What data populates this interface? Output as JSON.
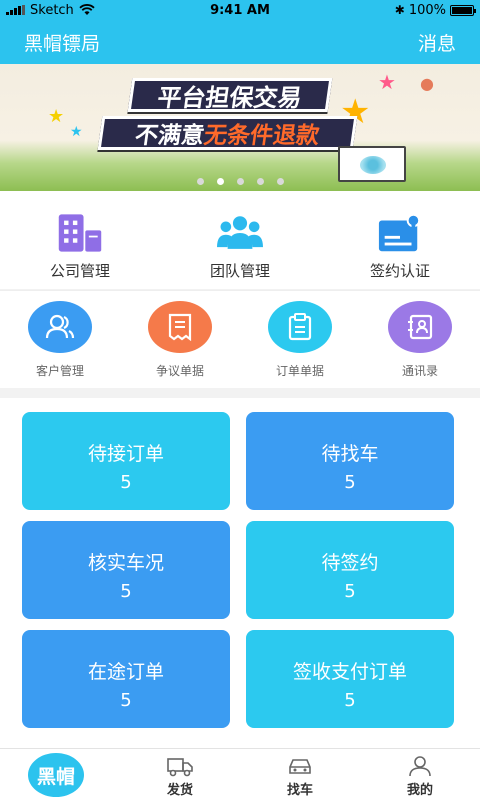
{
  "status_bar": {
    "carrier": "Sketch",
    "time": "9:41 AM",
    "battery": "100%"
  },
  "nav": {
    "title": "黑帽镖局",
    "action": "消息"
  },
  "banner": {
    "line1": "平台担保交易",
    "line2_prefix": "不满意",
    "line2_highlight": "无条件退款",
    "page_count": 5,
    "active_index": 1
  },
  "quick_main": [
    {
      "label": "公司管理",
      "icon": "building-icon"
    },
    {
      "label": "团队管理",
      "icon": "team-icon"
    },
    {
      "label": "签约认证",
      "icon": "contract-icon"
    }
  ],
  "quick_circle": [
    {
      "label": "客户管理",
      "icon": "users-icon",
      "color": "#3b9cf2"
    },
    {
      "label": "争议单据",
      "icon": "receipt-icon",
      "color": "#f57a4a"
    },
    {
      "label": "订单单据",
      "icon": "clipboard-icon",
      "color": "#2cc9ef"
    },
    {
      "label": "通讯录",
      "icon": "address-book-icon",
      "color": "#9b79e6"
    }
  ],
  "cards": [
    {
      "title": "待接订单",
      "count": "5",
      "color": "#2cc9ef"
    },
    {
      "title": "待找车",
      "count": "5",
      "color": "#3b9cf2"
    },
    {
      "title": "核实车况",
      "count": "5",
      "color": "#3b9cf2"
    },
    {
      "title": "待签约",
      "count": "5",
      "color": "#2cc9ef"
    },
    {
      "title": "在途订单",
      "count": "5",
      "color": "#3b9cf2"
    },
    {
      "title": "签收支付订单",
      "count": "5",
      "color": "#2cc9ef"
    }
  ],
  "tabs": {
    "home": "黑帽",
    "ship": "发货",
    "find_car": "找车",
    "mine": "我的"
  },
  "colors": {
    "primary": "#2cc3ee",
    "card_cyan": "#2cc9ef",
    "card_blue": "#3b9cf2",
    "icon_purple": "#8f6ee6"
  }
}
